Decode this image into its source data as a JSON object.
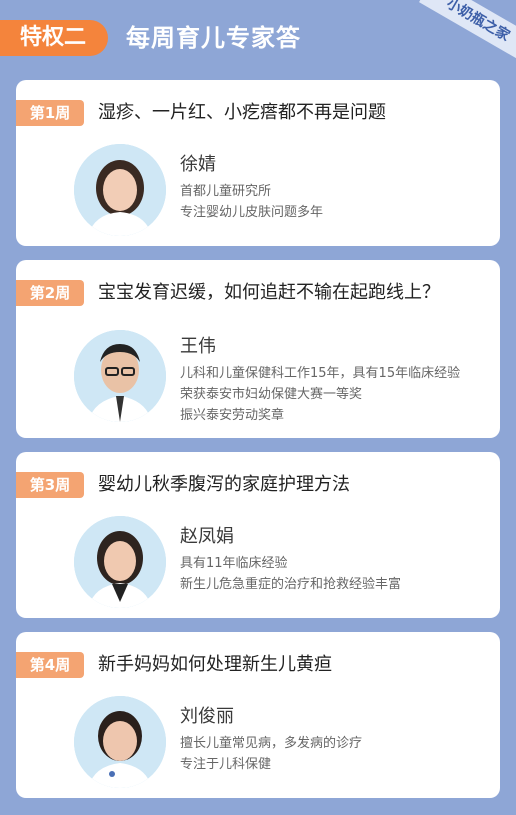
{
  "header": {
    "privilege_label": "特权二",
    "title": "每周育儿专家答",
    "corner_label": "小奶瓶之家"
  },
  "cards": [
    {
      "week": "第1周",
      "title": "湿疹、一片红、小疙瘩都不再是问题",
      "expert_name": "徐婧",
      "lines": [
        "首都儿童研究所",
        "专注婴幼儿皮肤问题多年"
      ]
    },
    {
      "week": "第2周",
      "title": "宝宝发育迟缓，如何追赶不输在起跑线上？",
      "expert_name": "王伟",
      "lines": [
        "儿科和儿童保健科工作15年，具有15年临床经验",
        "荣获泰安市妇幼保健大赛一等奖",
        "振兴泰安劳动奖章"
      ]
    },
    {
      "week": "第3周",
      "title": "婴幼儿秋季腹泻的家庭护理方法",
      "expert_name": "赵凤娟",
      "lines": [
        "具有11年临床经验",
        "新生儿危急重症的治疗和抢救经验丰富"
      ]
    },
    {
      "week": "第4周",
      "title": "新手妈妈如何处理新生儿黄疸",
      "expert_name": "刘俊丽",
      "lines": [
        "擅长儿童常见病，多发病的诊疗",
        "专注于儿科保健"
      ]
    }
  ]
}
